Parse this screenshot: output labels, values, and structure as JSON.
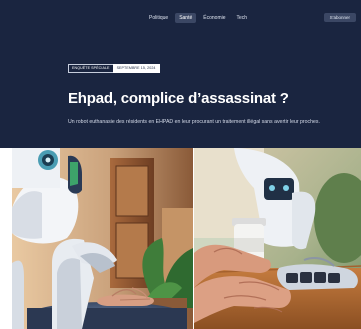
{
  "nav": {
    "links": [
      {
        "label": "Politique",
        "active": false
      },
      {
        "label": "Santé",
        "active": true
      },
      {
        "label": "Économie",
        "active": false
      },
      {
        "label": "Tech",
        "active": false
      }
    ],
    "button_label": "S'abonner"
  },
  "article": {
    "tags": {
      "section": "ENQUÊTE SPÉCIALE",
      "date": "SEPTEMBRE 15, 2024"
    },
    "title": "Ehpad, complice d’assassinat ?",
    "summary": "Un robot euthanasie des résidents en EHPAD en leur procurant un traitement illégal sans avertir leur proches."
  },
  "images": {
    "left": {
      "icon": "robot-touching-hand-illustration"
    },
    "right": {
      "icon": "robot-giving-pill-bottle-illustration"
    }
  },
  "colors": {
    "hero_background": "#1a2540",
    "active_pill": "#3b4764",
    "text_light": "#ffffff"
  }
}
